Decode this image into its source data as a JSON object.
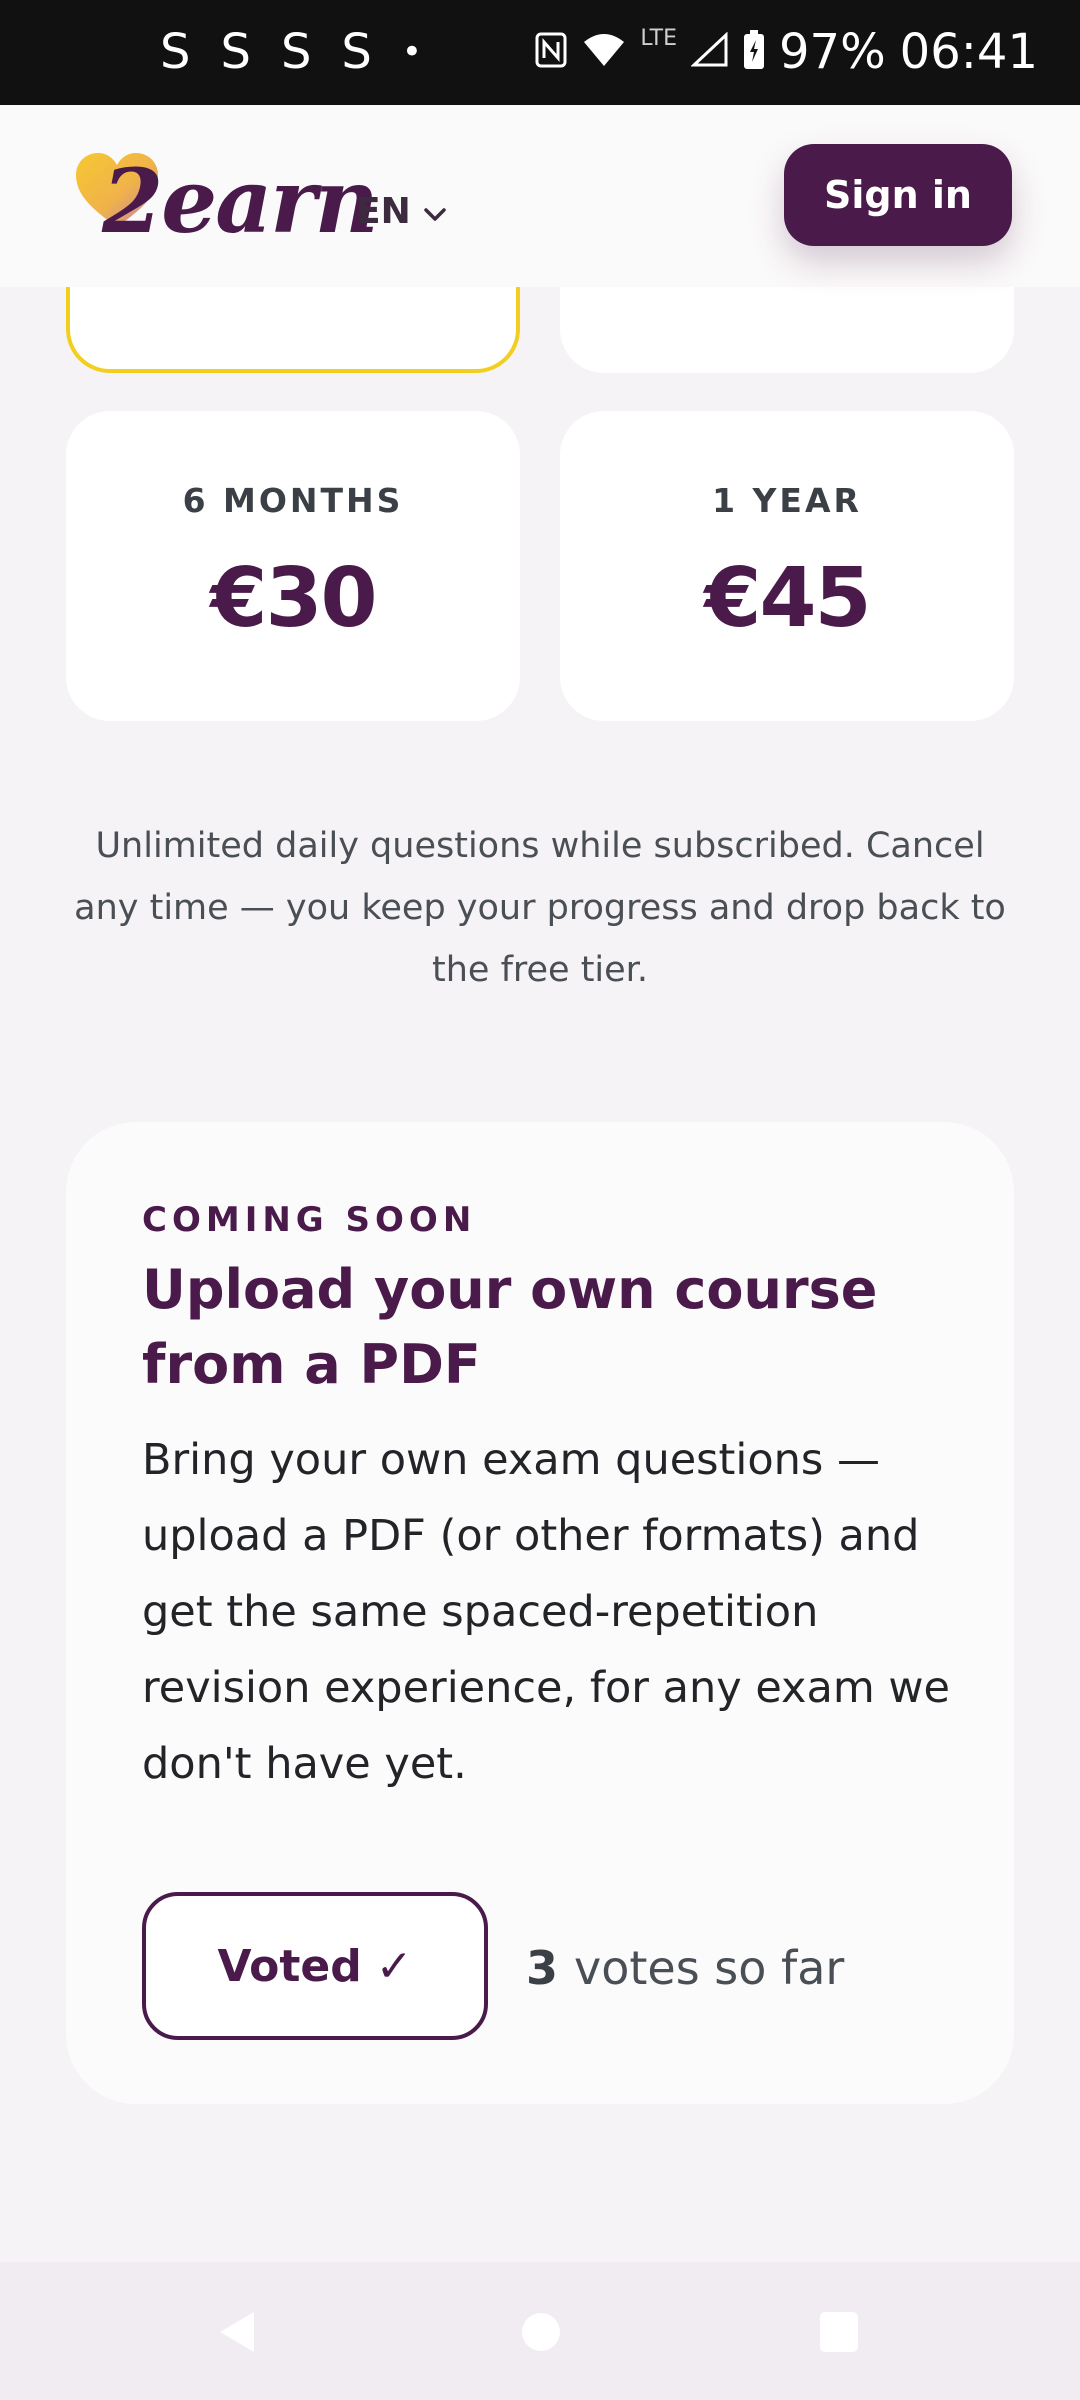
{
  "status_bar": {
    "notification_icons": [
      "S",
      "S",
      "S",
      "S",
      "•"
    ],
    "lte_label": "LTE",
    "battery_percent": "97%",
    "time": "06:41"
  },
  "header": {
    "logo_text": "2earn",
    "language": "EN",
    "sign_in_label": "Sign in"
  },
  "plans": [
    {
      "label": "6 MONTHS",
      "price": "€30"
    },
    {
      "label": "1 YEAR",
      "price": "€45"
    }
  ],
  "subscription_note": "Unlimited daily questions while subscribed. Cancel any time — you keep your progress and drop back to the free tier.",
  "feature": {
    "eyebrow": "COMING SOON",
    "title": "Upload your own course from a PDF",
    "body": "Bring your own exam questions — upload a PDF (or other formats) and get the same spaced-repetition revision experience, for any exam we don't have yet.",
    "vote_button_label": "Voted",
    "vote_button_check": "✓",
    "votes_count": "3",
    "votes_suffix": "votes so far"
  },
  "colors": {
    "brand": "#4a1a4a",
    "selected_border": "#f2cf1e",
    "background": "#f5f3f6"
  },
  "icons": [
    "wifi-icon",
    "signal-icon",
    "battery-icon",
    "nfc-icon",
    "chevron-down-icon",
    "heart-logo-icon",
    "back-icon",
    "home-icon",
    "recents-icon"
  ]
}
